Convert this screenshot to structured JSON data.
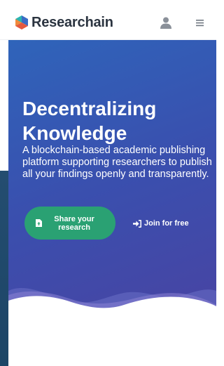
{
  "header": {
    "brand_name": "Researchain",
    "logo_colors": [
      "#2bb5b1",
      "#e4593e",
      "#3a6cc4"
    ],
    "user_icon": "user-icon",
    "menu_icon": "hamburger-menu-icon"
  },
  "hero": {
    "title": "Decentralizing Knowledge",
    "subtitle": "A blockchain-based academic publishing platform supporting researchers to publish all your findings openly and transparently.",
    "share_button": {
      "label": "Share your research",
      "icon": "upload-file-icon",
      "color": "#2aa173"
    },
    "join_link": {
      "label": "Join for free",
      "icon": "sign-in-icon"
    },
    "gradient_colors": [
      "#2f64ba",
      "#4c41a0"
    ]
  }
}
